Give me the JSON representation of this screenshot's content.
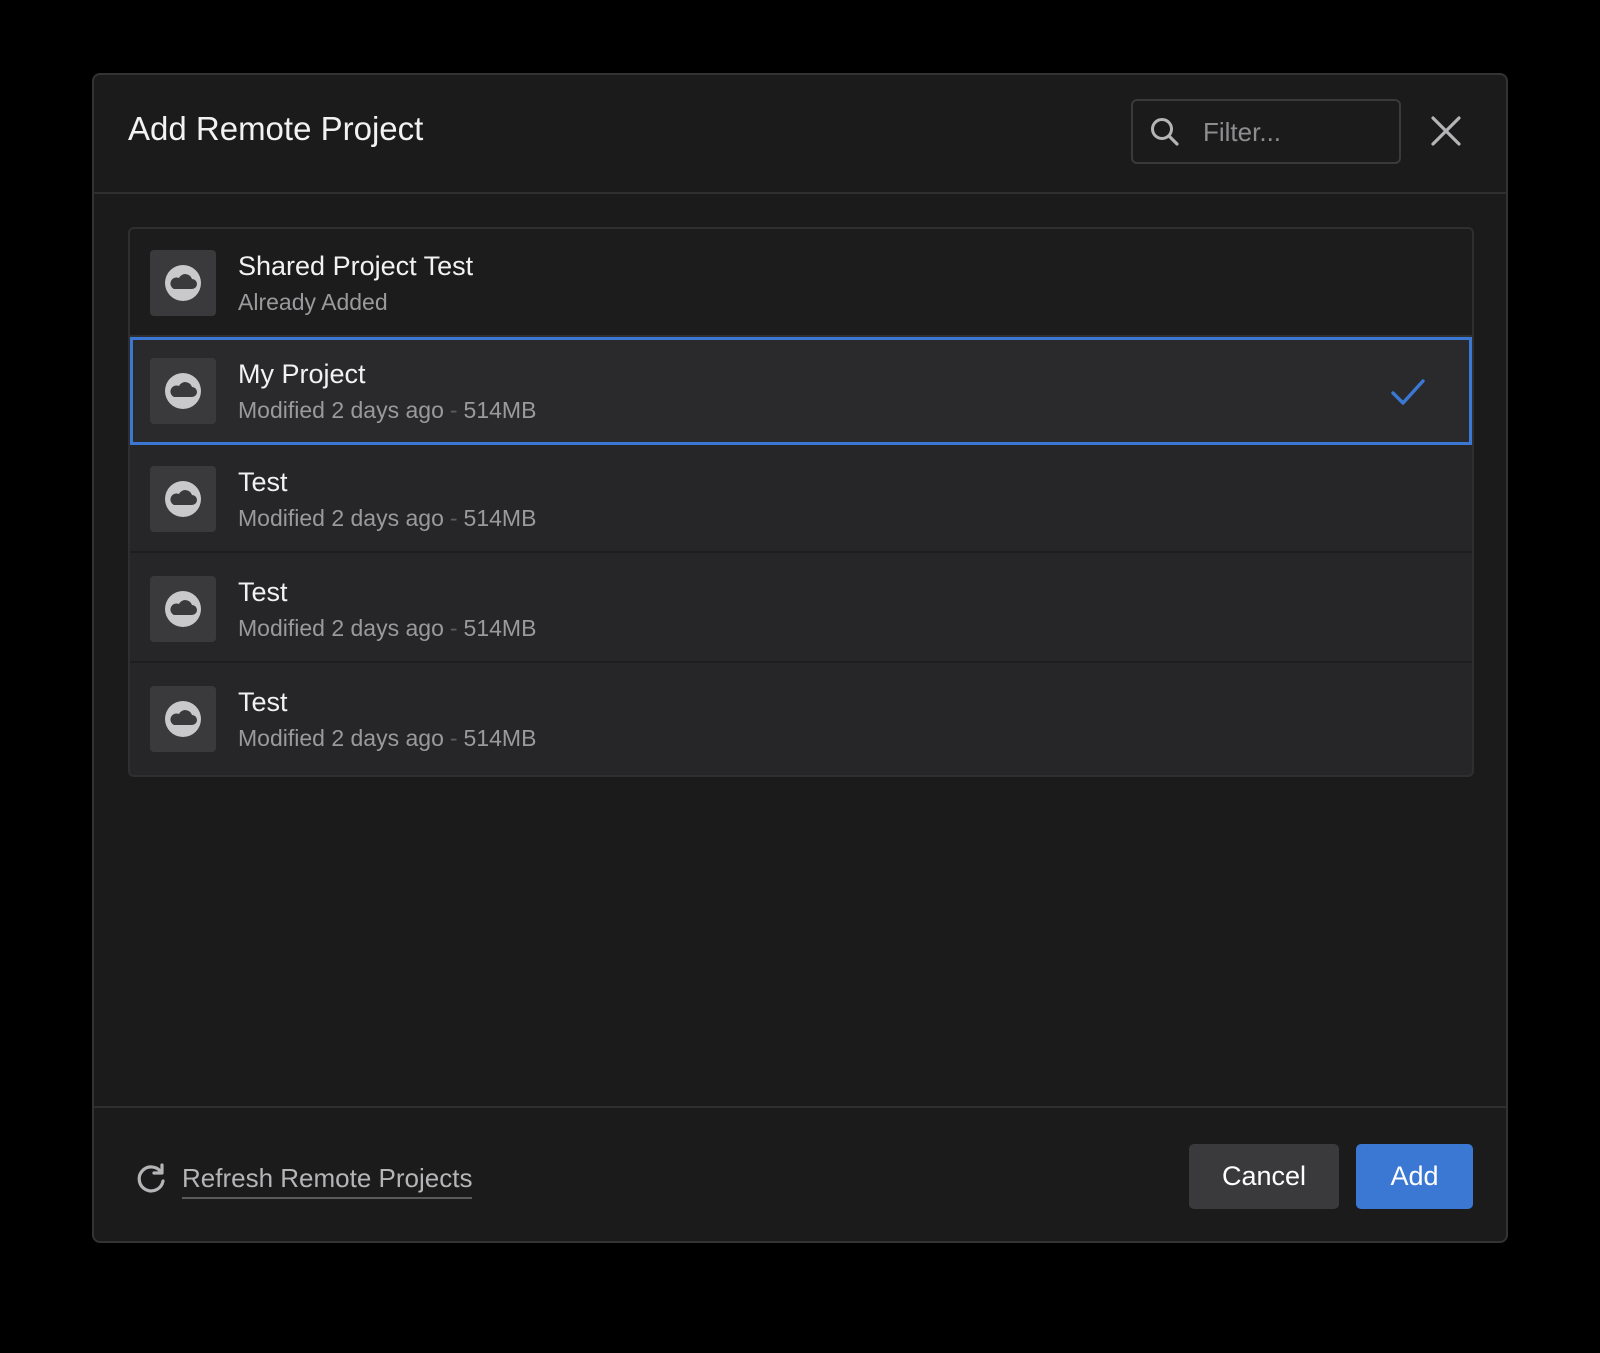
{
  "dialog": {
    "title": "Add Remote Project",
    "filter": {
      "placeholder": "Filter...",
      "value": ""
    },
    "close_icon": "close-icon"
  },
  "projects": [
    {
      "name": "Shared Project Test",
      "status": "Already Added",
      "detail": "",
      "selected": false,
      "disabled": true
    },
    {
      "name": "My Project",
      "status": "Modified 2 days ago",
      "detail": "514MB",
      "selected": true,
      "disabled": false
    },
    {
      "name": "Test",
      "status": "Modified 2 days ago",
      "detail": "514MB",
      "selected": false,
      "disabled": false
    },
    {
      "name": "Test",
      "status": "Modified 2 days ago",
      "detail": "514MB",
      "selected": false,
      "disabled": false
    },
    {
      "name": "Test",
      "status": "Modified 2 days ago",
      "detail": "514MB",
      "selected": false,
      "disabled": false
    }
  ],
  "separator": "-",
  "footer": {
    "refresh_label": "Refresh Remote Projects",
    "cancel_label": "Cancel",
    "add_label": "Add"
  },
  "colors": {
    "accent": "#3b78d4",
    "background": "#1b1b1c",
    "row": "#262628",
    "thumb": "#3a3a3c"
  }
}
